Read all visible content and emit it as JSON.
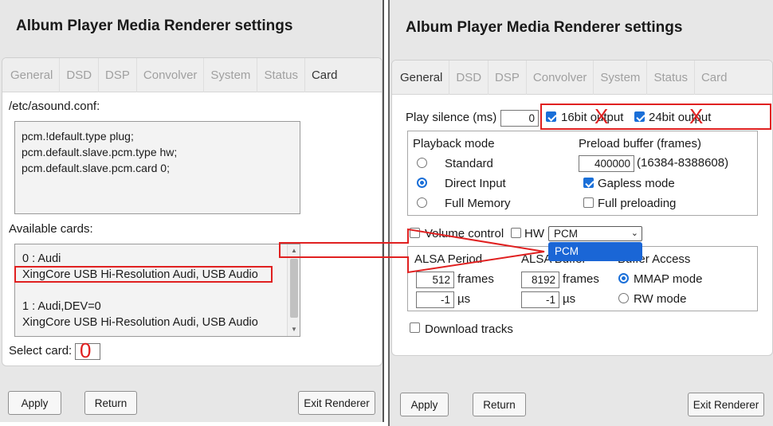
{
  "left": {
    "title": "Album Player Media Renderer settings",
    "tabs": [
      "General",
      "DSD",
      "DSP",
      "Convolver",
      "System",
      "Status",
      "Card"
    ],
    "asound_label": "/etc/asound.conf:",
    "asound_lines": [
      "pcm.!default.type plug;",
      "pcm.default.slave.pcm.type hw;",
      "pcm.default.slave.pcm.card 0;"
    ],
    "available_label": "Available cards:",
    "cards": [
      "0 : Audi",
      "XingCore USB Hi-Resolution Audi, USB Audio",
      "",
      "1 : Audi,DEV=0",
      "XingCore USB Hi-Resolution Audi, USB Audio"
    ],
    "select_card_label": "Select card:",
    "select_card_value": "0",
    "buttons": {
      "apply": "Apply",
      "return": "Return",
      "exit": "Exit Renderer"
    }
  },
  "right": {
    "title": "Album Player Media Renderer settings",
    "tabs": [
      "General",
      "DSD",
      "DSP",
      "Convolver",
      "System",
      "Status",
      "Card"
    ],
    "play_silence_label": "Play silence (ms)",
    "play_silence_value": "0",
    "bit16_label": "16bit output",
    "bit24_label": "24bit output",
    "x_mark": "X",
    "playback_mode_label": "Playback mode",
    "mode_standard": "Standard",
    "mode_direct": "Direct Input",
    "mode_full_memory": "Full Memory",
    "preload_label": "Preload buffer (frames)",
    "preload_value": "400000",
    "preload_range": "(16384-8388608)",
    "gapless_label": "Gapless mode",
    "full_preloading_label": "Full preloading",
    "volume_label": "Volume control",
    "hw_label": "HW",
    "volume_select_value": "PCM",
    "dropdown_option": "PCM",
    "alsa_period_label": "ALSA Period",
    "alsa_buffer_label": "ALSA Buffer",
    "buffer_access_label": "Buffer Access",
    "period_frames_value": "512",
    "period_us_value": "-1",
    "buffer_frames_value": "8192",
    "buffer_us_value": "-1",
    "frames_unit": "frames",
    "us_unit": "µs",
    "mmap_label": "MMAP mode",
    "rw_label": "RW mode",
    "download_label": "Download tracks",
    "buttons": {
      "apply": "Apply",
      "return": "Return",
      "exit": "Exit Renderer"
    }
  },
  "colors": {
    "annotation": "#e02020",
    "accent": "#1a6fd8"
  }
}
